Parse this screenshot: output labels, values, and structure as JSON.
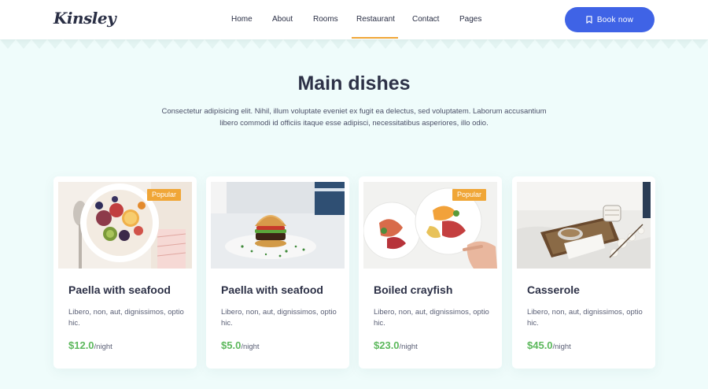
{
  "header": {
    "logo": "Kinsley",
    "nav": [
      {
        "label": "Home"
      },
      {
        "label": "About"
      },
      {
        "label": "Rooms"
      },
      {
        "label": "Restaurant",
        "active": true
      },
      {
        "label": "Contact"
      },
      {
        "label": "Pages"
      }
    ],
    "book_button": {
      "label": "Book now",
      "icon": "bookmark-icon"
    }
  },
  "section": {
    "title": "Main dishes",
    "description": "Consectetur adipisicing elit. Nihil, illum voluptate eveniet ex fugit ea delectus, sed voluptatem. Laborum accusantium libero commodi id officiis itaque esse adipisci, necessitatibus asperiores, illo odio."
  },
  "cards": [
    {
      "title": "Paella with seafood",
      "description": "Libero, non, aut, dignissimos, optio hic.",
      "price": "$12.0",
      "unit": "/night",
      "badge": "Popular",
      "image": "fruit-bowl-photo"
    },
    {
      "title": "Paella with seafood",
      "description": "Libero, non, aut, dignissimos, optio hic.",
      "price": "$5.0",
      "unit": "/night",
      "badge": "",
      "image": "burger-photo"
    },
    {
      "title": "Boiled crayfish",
      "description": "Libero, non, aut, dignissimos, optio hic.",
      "price": "$23.0",
      "unit": "/night",
      "badge": "Popular",
      "image": "plated-dishes-photo"
    },
    {
      "title": "Casserole",
      "description": "Libero, non, aut, dignissimos, optio hic.",
      "price": "$45.0",
      "unit": "/night",
      "badge": "",
      "image": "breakfast-tray-photo"
    }
  ],
  "colors": {
    "accent": "#3f63e6",
    "badge": "#f0a637",
    "price": "#5cb85c",
    "background": "#effcfb",
    "heading": "#2d3147"
  }
}
